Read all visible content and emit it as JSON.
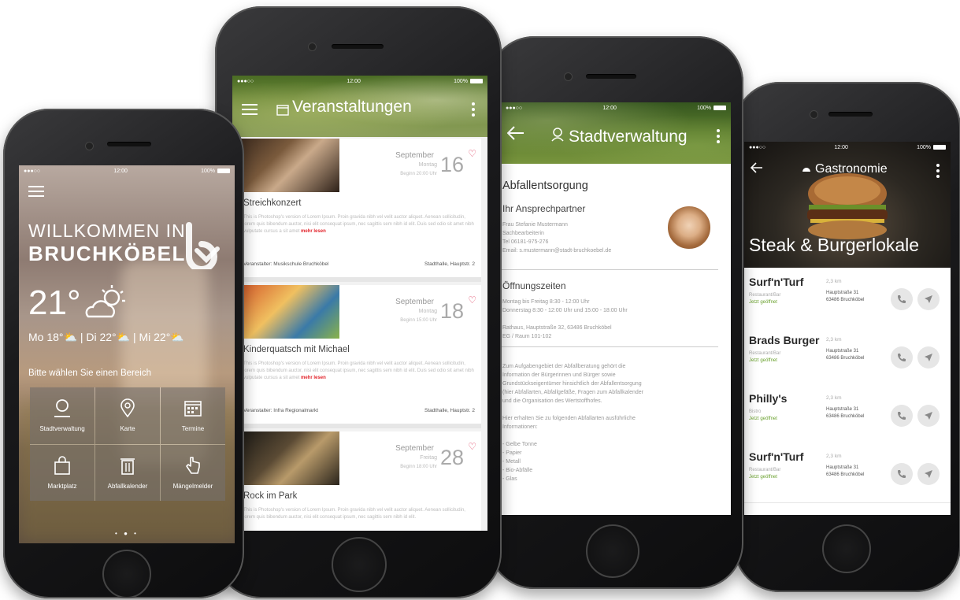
{
  "status": {
    "carrier": "●●●○○ ",
    "time": "12:00",
    "battery": "100%"
  },
  "p1": {
    "welcome_line1": "WILLKOMMEN IN",
    "welcome_line2": "BRUCHKÖBEL",
    "temperature": "21°",
    "forecast": "Mo 18°⛅ | Di 22°⛅ | Mi 22°⛅",
    "prompt": "Bitte wählen Sie einen Bereich",
    "tiles": [
      {
        "label": "Stadtverwaltung",
        "icon": "person-icon"
      },
      {
        "label": "Karte",
        "icon": "location-pin-icon"
      },
      {
        "label": "Termine",
        "icon": "calendar-icon"
      },
      {
        "label": "Marktplatz",
        "icon": "shopping-bag-icon"
      },
      {
        "label": "Abfallkalender",
        "icon": "trash-icon"
      },
      {
        "label": "Mängelmelder",
        "icon": "pointing-hand-icon"
      }
    ],
    "page_dots": "• ● •"
  },
  "p2": {
    "title": "Veranstaltungen",
    "events": [
      {
        "month": "September",
        "day": "Montag",
        "time": "Beginn 20:00 Uhr",
        "num": "16",
        "title": "Streichkonzert",
        "lorem": "This is Photoshop's version of Lorem Ipsum. Proin gravida nibh vel velit auctor aliquet. Aenean sollicitudin, lorem quis bibendum auctor, nisi elit consequat ipsum, nec sagittis sem nibh id elit. Duis sed odio sit amet nibh vulputate cursus a sit amet",
        "more": "mehr lesen",
        "organizer": "Veranstalter: Musikschule Bruchköbel",
        "place": "Stadthalle, Hauptstr. 2"
      },
      {
        "month": "September",
        "day": "Montag",
        "time": "Beginn 15:00 Uhr",
        "num": "18",
        "title": "Kinderquatsch mit Michael",
        "lorem": "This is Photoshop's version of Lorem Ipsum. Proin gravida nibh vel velit auctor aliquet. Aenean sollicitudin, lorem quis bibendum auctor, nisi elit consequat ipsum, nec sagittis sem nibh id elit. Duis sed odio sit amet nibh vulputate cursus a sit amet",
        "more": "mehr lesen",
        "organizer": "Veranstalter: Infra Regionalmarkt",
        "place": "Stadthalle, Hauptstr. 2"
      },
      {
        "month": "September",
        "day": "Freitag",
        "time": "Beginn 18:00 Uhr",
        "num": "28",
        "title": "Rock im Park",
        "lorem": "This is Photoshop's version of Lorem Ipsum. Proin gravida nibh vel velit auctor aliquet. Aenean sollicitudin, lorem quis bibendum auctor, nisi elit consequat ipsum, nec sagittis sem nibh id elit.",
        "more": "",
        "organizer": "",
        "place": ""
      }
    ]
  },
  "p3": {
    "title": "Stadtverwaltung",
    "section": "Abfallentsorgung",
    "contact_heading": "Ihr Ansprechpartner",
    "contact_lines": [
      "Frau Stefanie Mustermann",
      "Sachbearbeiterin",
      "Tel 06181-975-276",
      "Email: s.mustermann@stadt-bruchkoebel.de"
    ],
    "hours_heading": "Öffnungszeiten",
    "hours_lines": [
      "Montag bis Freitag 8:30 - 12:00 Uhr",
      "Donnerstag 8:30 - 12:00 Uhr und 15:00 - 18:00 Uhr",
      "",
      "Rathaus, Hauptstraße 32, 63486 Bruchköbel",
      "EG / Raum 101-102"
    ],
    "info_lines": [
      "Zum Aufgabengebiet der Abfallberatung gehört die",
      "Information der Bürgerinnen und Bürger sowie",
      "Grundstückseigentümer hinsichtlich der Abfallentsorgung",
      "(hier Abfallarten, Abfallgefäße, Fragen zum Abfallkalender",
      "und die Organisation des Wertstoffhofes.",
      "",
      "Hier erhalten Sie zu folgenden Abfallarten ausführliche",
      "Informationen:",
      "",
      "- Gelbe Tonne",
      "- Papier",
      "- Metall",
      "- Bio-Abfälle",
      "- Glas"
    ]
  },
  "p4": {
    "title": "Gastronomie",
    "banner": "Steak & Burgerlokale",
    "restaurants": [
      {
        "name": "Surf'n'Turf",
        "type": "Restaurant/Bar",
        "open": "Jetzt geöffnet",
        "dist": "2,3 km",
        "addr1": "Hauptstraße 31",
        "addr2": "63486 Bruchköbel"
      },
      {
        "name": "Brads Burger",
        "type": "Restaurant/Bar",
        "open": "Jetzt geöffnet",
        "dist": "2,3 km",
        "addr1": "Hauptstraße 31",
        "addr2": "63486 Bruchköbel"
      },
      {
        "name": "Philly's",
        "type": "Bistro",
        "open": "Jetzt geöffnet",
        "dist": "2,3 km",
        "addr1": "Hauptstraße 31",
        "addr2": "63486 Bruchköbel"
      },
      {
        "name": "Surf'n'Turf",
        "type": "Restaurant/Bar",
        "open": "Jetzt geöffnet",
        "dist": "2,3 km",
        "addr1": "Hauptstraße 31",
        "addr2": "63486 Bruchköbel"
      }
    ]
  },
  "colors": {
    "accent_red": "#e2232a",
    "heart_pink": "#e04a68",
    "open_green": "#6aa12e",
    "header_green": "#5b7c2d"
  }
}
